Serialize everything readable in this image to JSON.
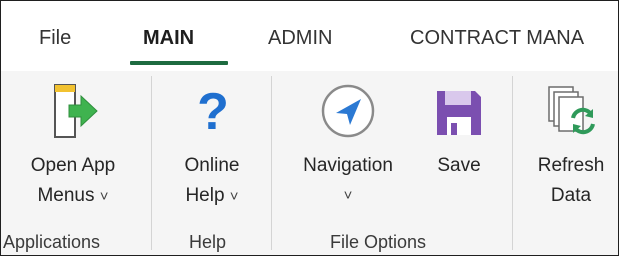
{
  "tabs": {
    "file": "File",
    "main": "MAIN",
    "admin": "ADMIN",
    "contract": "CONTRACT MANA"
  },
  "buttons": {
    "open_app_menus": {
      "line1": "Open App",
      "line2": "Menus",
      "chevron": "˅",
      "icon": "open-app-icon"
    },
    "online_help": {
      "line1": "Online",
      "line2": "Help",
      "chevron": "˅",
      "icon": "help-icon"
    },
    "navigation": {
      "line1": "Navigation",
      "chevron": "˅",
      "icon": "compass-icon"
    },
    "save": {
      "line1": "Save",
      "icon": "floppy-disk-icon"
    },
    "refresh_data": {
      "line1": "Refresh",
      "line2": "Data",
      "icon": "refresh-data-icon"
    }
  },
  "groups": {
    "applications": "Applications",
    "help": "Help",
    "file_options": "File Options"
  },
  "colors": {
    "tab_accent": "#1d6b40",
    "help_blue": "#1f6fcf",
    "save_purple": "#7b4fb0",
    "arrow_green": "#3fb34f",
    "nav_blue": "#2b79d3"
  }
}
